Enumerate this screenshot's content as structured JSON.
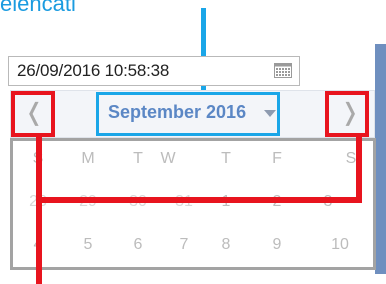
{
  "heading": "elencati",
  "date_input": {
    "value": "26/09/2016 10:58:38",
    "icon": "calendar-grid-icon"
  },
  "calendar": {
    "month_label": "September 2016",
    "prev_glyph": "❬",
    "next_glyph": "❭",
    "weekdays": [
      "S",
      "M",
      "T",
      "W",
      "T",
      "F",
      "S"
    ],
    "week1": [
      "28",
      "29",
      "30",
      "31",
      "1",
      "2",
      "3"
    ],
    "week2": [
      "4",
      "5",
      "6",
      "7",
      "8",
      "9",
      "10"
    ]
  },
  "colors": {
    "highlight_blue": "#1aa6e8",
    "highlight_red": "#e8141e",
    "month_text": "#5b87c5"
  }
}
